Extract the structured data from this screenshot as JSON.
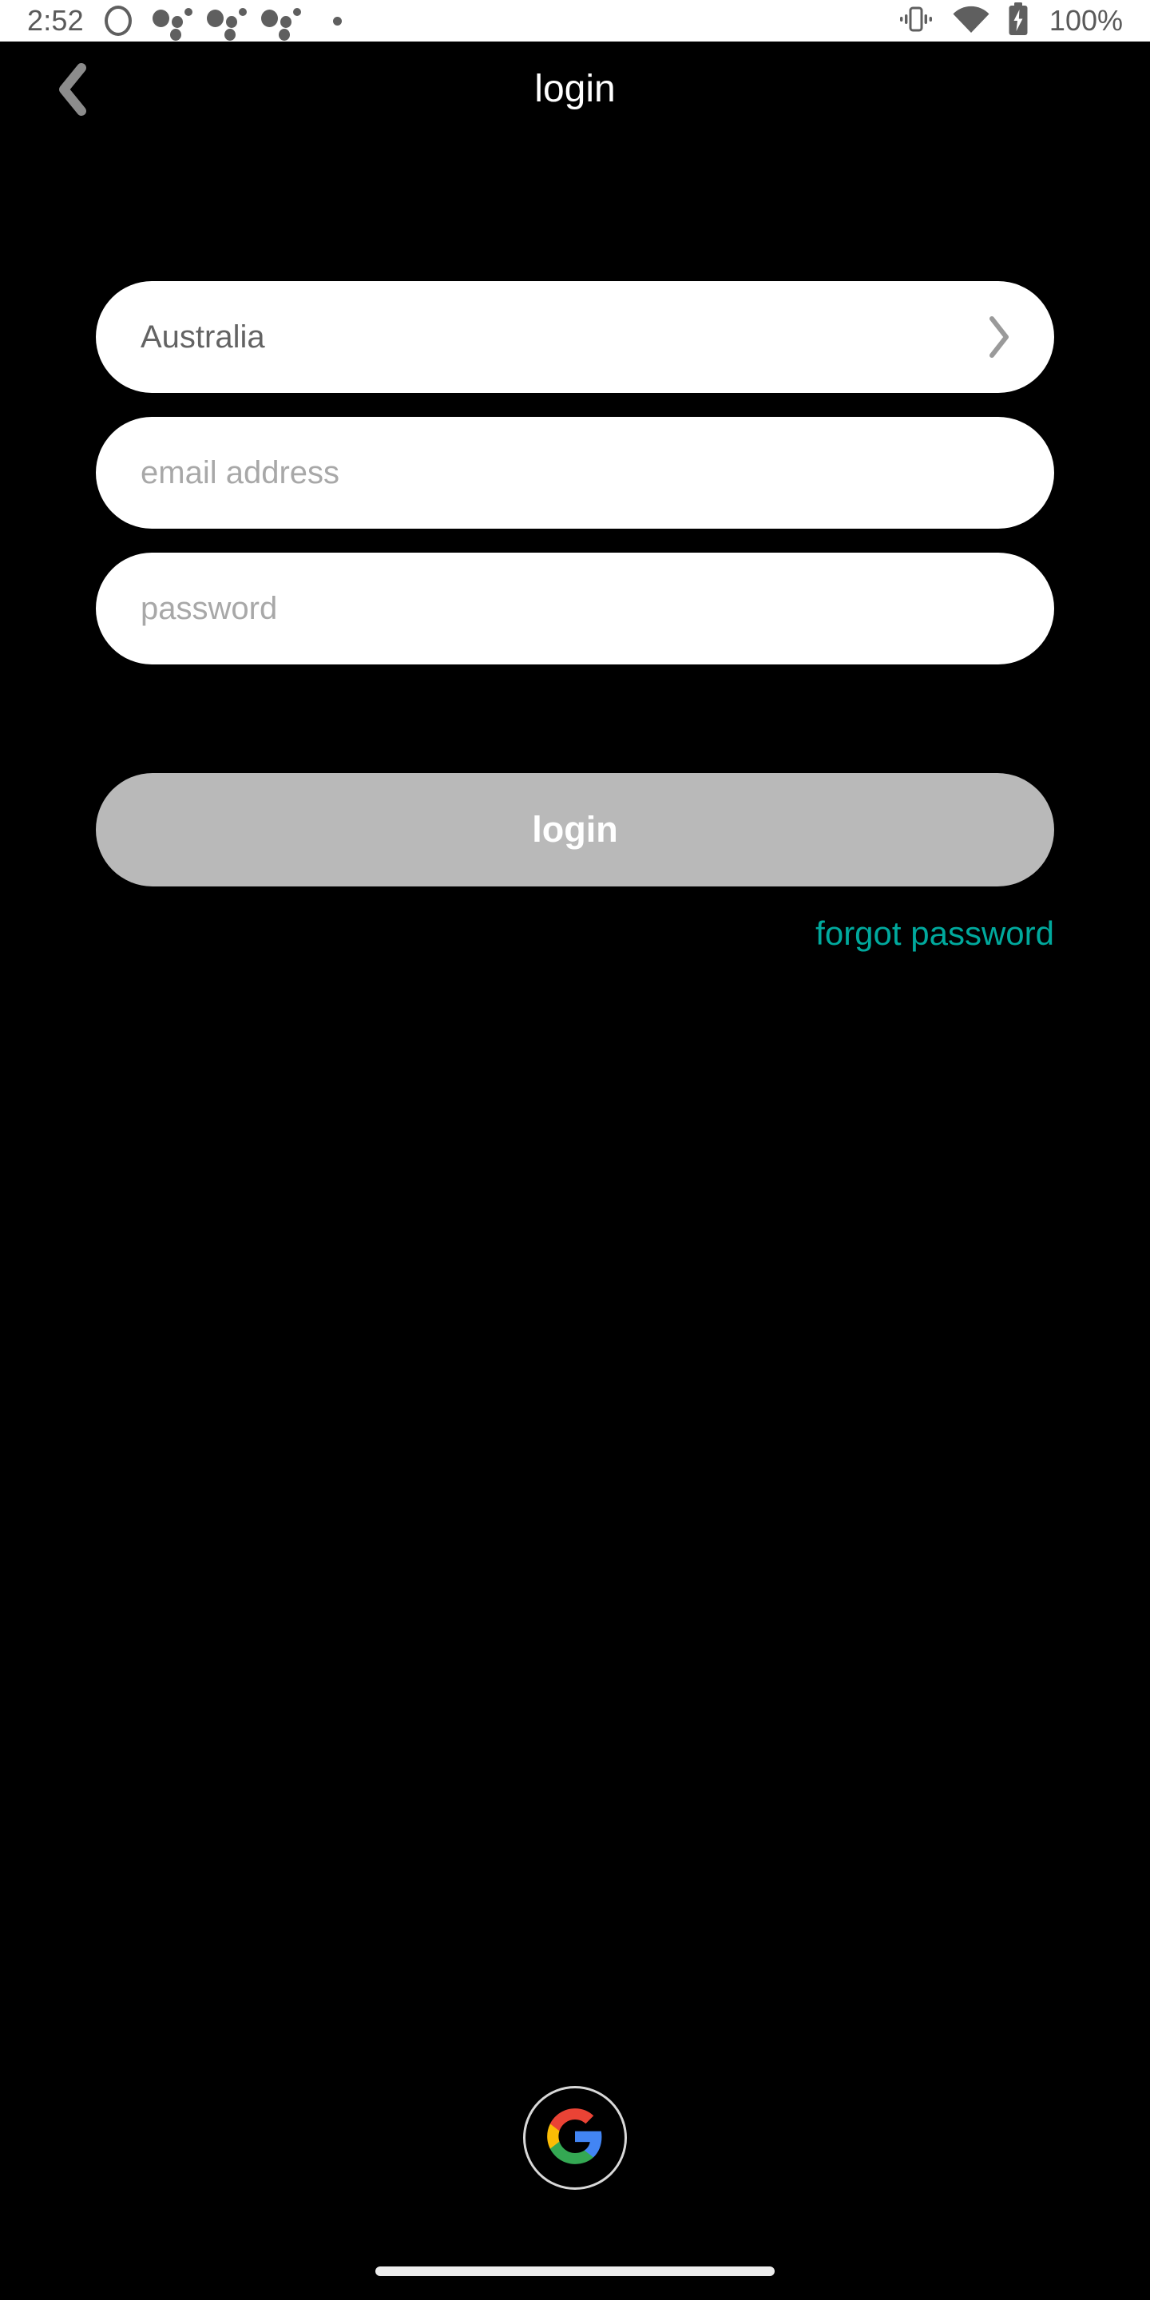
{
  "status_bar": {
    "time": "2:52",
    "battery_percent": "100%",
    "left_icons": [
      "circle-ring-icon",
      "notification-cluster-icon",
      "notification-cluster-icon",
      "notification-cluster-icon",
      "notification-dot-icon"
    ],
    "right_icons": [
      "vibrate-icon",
      "wifi-icon",
      "battery-charging-icon"
    ],
    "background_color": "#ffffff",
    "icon_color": "#5f5f5f"
  },
  "header": {
    "title": "login",
    "back_icon": "chevron-left-icon",
    "back_icon_color": "#8c8c8c",
    "title_color": "#ffffff"
  },
  "form": {
    "country_field": {
      "value": "Australia",
      "chevron_icon": "chevron-right-icon"
    },
    "email_field": {
      "value": "",
      "placeholder": "email address"
    },
    "password_field": {
      "value": "",
      "placeholder": "password"
    }
  },
  "actions": {
    "login_label": "login",
    "login_button_color": "#b9b9b9",
    "login_text_color": "#ffffff",
    "forgot_password_label": "forgot password",
    "forgot_password_color": "#00a99d"
  },
  "social": {
    "google_icon": "google-g-icon",
    "google_colors": {
      "blue": "#4285F4",
      "green": "#34A853",
      "yellow": "#FBBC05",
      "red": "#EA4335"
    }
  },
  "screen": {
    "background_color": "#000000"
  }
}
